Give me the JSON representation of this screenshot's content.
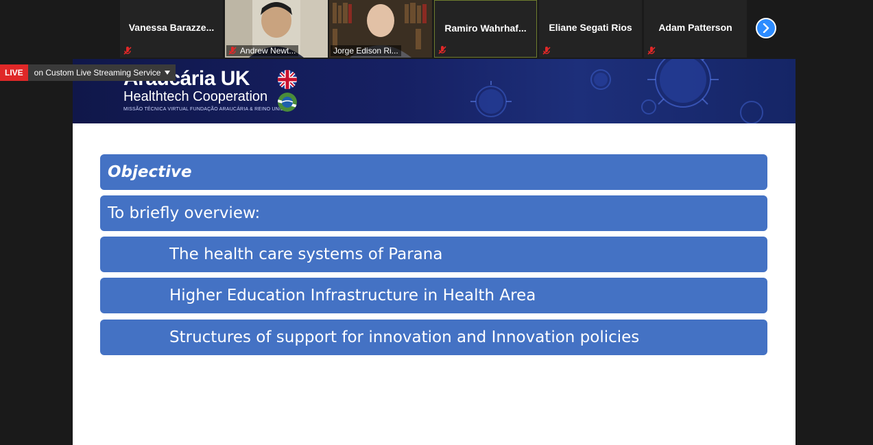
{
  "participants": [
    {
      "name": "Vanessa  Barazze...",
      "video": false,
      "muted": true
    },
    {
      "name": "Andrew Newt...",
      "video": true,
      "muted": true
    },
    {
      "name": "Jorge Edison Ri...",
      "video": true,
      "muted": false
    },
    {
      "name": "Ramiro  Wahrhaf...",
      "video": false,
      "muted": true,
      "active_speaker": true
    },
    {
      "name": "Eliane Segati Rios",
      "video": false,
      "muted": true
    },
    {
      "name": "Adam Patterson",
      "video": false,
      "muted": true
    }
  ],
  "live": {
    "badge": "LIVE",
    "service": "on Custom Live Streaming Service"
  },
  "slide": {
    "brand": {
      "title": "Araucária UK",
      "subtitle": "Healthtech Cooperation",
      "tagline": "MISSÃO TÉCNICA VIRTUAL FUNDAÇÃO ARAUCÁRIA & REINO UNIDO"
    },
    "heading": "Objective",
    "intro": "To briefly overview:",
    "items": [
      "The health care systems of Parana",
      "Higher Education Infrastructure in Health Area",
      "Structures of support for innovation and Innovation policies"
    ]
  },
  "colors": {
    "accent": "#4472c4",
    "live": "#e02828",
    "nav": "#2d8cff",
    "banner": "#162063"
  }
}
